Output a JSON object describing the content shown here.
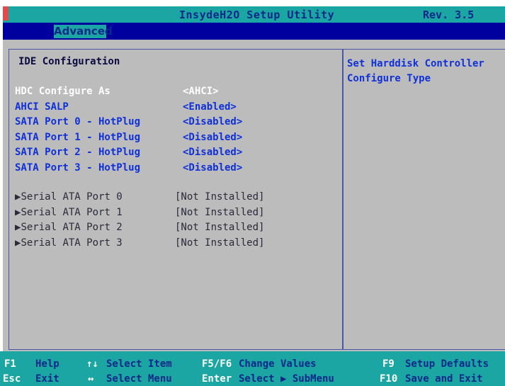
{
  "header": {
    "title": "InsydeH2O Setup Utility",
    "revision": "Rev. 3.5"
  },
  "tabs": [
    {
      "label": "Advanced",
      "active": true
    }
  ],
  "main": {
    "section_title": "IDE Configuration",
    "settings": [
      {
        "label": "HDC Configure As",
        "value": "<AHCI>",
        "selected": true
      },
      {
        "label": "AHCI SALP",
        "value": "<Enabled>",
        "selected": false
      },
      {
        "label": "SATA Port 0 - HotPlug",
        "value": "<Disabled>",
        "selected": false
      },
      {
        "label": "SATA Port 1 - HotPlug",
        "value": "<Disabled>",
        "selected": false
      },
      {
        "label": "SATA Port 2 - HotPlug",
        "value": "<Disabled>",
        "selected": false
      },
      {
        "label": "SATA Port 3 - HotPlug",
        "value": "<Disabled>",
        "selected": false
      }
    ],
    "submenus": [
      {
        "arrow": "▶",
        "label": "Serial ATA Port 0",
        "value": "[Not Installed]"
      },
      {
        "arrow": "▶",
        "label": "Serial ATA Port 1",
        "value": "[Not Installed]"
      },
      {
        "arrow": "▶",
        "label": "Serial ATA Port 2",
        "value": "[Not Installed]"
      },
      {
        "arrow": "▶",
        "label": "Serial ATA Port 3",
        "value": "[Not Installed]"
      }
    ]
  },
  "help": {
    "text": "Set Harddisk Controller\nConfigure Type"
  },
  "footer": {
    "keys": [
      {
        "key": "F1",
        "desc": "Help"
      },
      {
        "key": "↑↓",
        "desc": "Select Item"
      },
      {
        "key": "F5/F6",
        "desc": "Change Values"
      },
      {
        "key": "F9",
        "desc": "Setup Defaults"
      },
      {
        "key": "Esc",
        "desc": "Exit"
      },
      {
        "key": "↔",
        "desc": "Select Menu"
      },
      {
        "key": "Enter",
        "desc": "Select ▶ SubMenu"
      },
      {
        "key": "F10",
        "desc": "Save and Exit"
      }
    ]
  },
  "colors": {
    "title_bar": "#1ba5a3",
    "tab_band": "#00009f",
    "panel_bg": "#bcbcbc",
    "value_blue": "#1131d8",
    "selected_white": "#ffffff"
  }
}
